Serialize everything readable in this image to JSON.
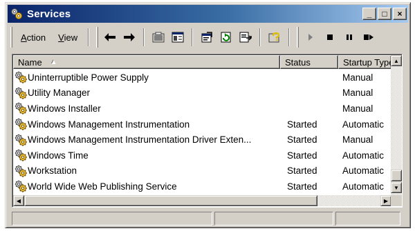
{
  "window": {
    "title": "Services",
    "icon": "services-gear-icon"
  },
  "title_buttons": {
    "minimize": "_",
    "maximize": "□",
    "close": "×"
  },
  "menu": {
    "action_label": "Action",
    "action_accel": "A",
    "action_rest": "ction",
    "view_label": "View",
    "view_accel": "V",
    "view_rest": "iew"
  },
  "toolbar_icons": [
    "back-arrow-icon",
    "forward-arrow-icon",
    "show-hide-tree-icon",
    "export-list-icon",
    "properties-icon",
    "refresh-icon",
    "export-icon",
    "help-icon",
    "start-service-icon",
    "stop-service-icon",
    "pause-service-icon",
    "restart-service-icon"
  ],
  "columns": {
    "name": "Name",
    "name_sort": "▲",
    "status": "Status",
    "startup": "Startup Type"
  },
  "rows": [
    {
      "name": "Uninterruptible Power Supply",
      "status": "",
      "startup": "Manual"
    },
    {
      "name": "Utility Manager",
      "status": "",
      "startup": "Manual"
    },
    {
      "name": "Windows Installer",
      "status": "",
      "startup": "Manual"
    },
    {
      "name": "Windows Management Instrumentation",
      "status": "Started",
      "startup": "Automatic"
    },
    {
      "name": "Windows Management Instrumentation Driver Exten...",
      "status": "Started",
      "startup": "Manual"
    },
    {
      "name": "Windows Time",
      "status": "Started",
      "startup": "Automatic"
    },
    {
      "name": "Workstation",
      "status": "Started",
      "startup": "Automatic"
    },
    {
      "name": "World Wide Web Publishing Service",
      "status": "Started",
      "startup": "Automatic"
    }
  ],
  "scrollbar": {
    "up": "▲",
    "down": "▼",
    "left": "◀",
    "right": "▶"
  },
  "colors": {
    "title_gradient_start": "#0a246a",
    "title_gradient_end": "#a6caf0",
    "face": "#d4d0c8"
  }
}
